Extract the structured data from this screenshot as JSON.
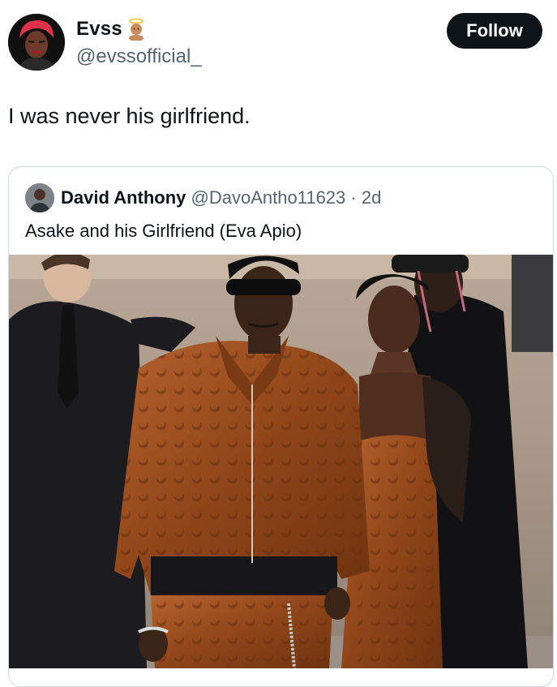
{
  "tweet": {
    "author_name": "Evss",
    "author_handle": "@evssofficial_",
    "follow_label": "Follow",
    "text": "I was never his girlfriend.",
    "name_emoji": "angel-baby-emoji"
  },
  "quoted_tweet": {
    "author_name": "David Anthony",
    "author_handle": "@DavoAntho11623",
    "separator": "·",
    "time": "2d",
    "text": "Asake and his Girlfriend (Eva Apio)"
  },
  "colors": {
    "follow_bg": "#0f1419",
    "muted_text": "#536471",
    "border": "#cfd9de",
    "jacket": "#9a4a1f"
  }
}
